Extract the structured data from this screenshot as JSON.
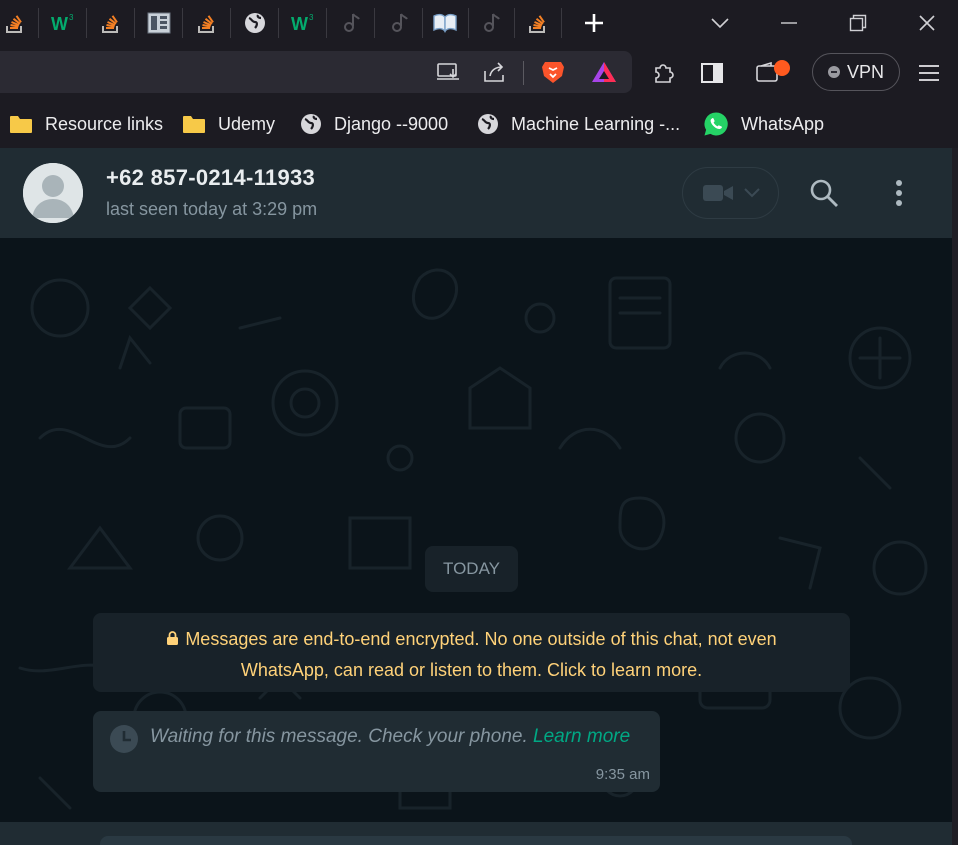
{
  "browser": {
    "tabs": [
      {
        "icon": "stackoverflow-icon"
      },
      {
        "icon": "w3schools-icon",
        "glyph": "W",
        "sup": "3"
      },
      {
        "icon": "stackoverflow-icon"
      },
      {
        "icon": "sidebar-panel-icon"
      },
      {
        "icon": "stackoverflow-icon"
      },
      {
        "icon": "globe-icon"
      },
      {
        "icon": "w3schools-icon",
        "glyph": "W",
        "sup": "3"
      },
      {
        "icon": "music-note-icon"
      },
      {
        "icon": "music-note-icon"
      },
      {
        "icon": "book-icon"
      },
      {
        "icon": "music-note-icon"
      },
      {
        "icon": "stackoverflow-icon"
      }
    ],
    "vpn_label": "VPN",
    "colors": {
      "accent_orange": "#f48024",
      "w3_green": "#04aa6d",
      "brave_orange": "#fb542b"
    }
  },
  "bookmarks": [
    {
      "label": "Resource links",
      "icon": "folder-icon"
    },
    {
      "label": "Udemy",
      "icon": "folder-icon"
    },
    {
      "label": "Django --9000",
      "icon": "globe-icon"
    },
    {
      "label": "Machine Learning -...",
      "icon": "globe-icon"
    },
    {
      "label": "WhatsApp",
      "icon": "whatsapp-icon"
    }
  ],
  "chat": {
    "contact_name": "+62 857-0214-11933",
    "last_seen": "last seen today at 3:29 pm",
    "day_label": "TODAY",
    "encryption_notice": "Messages are end-to-end encrypted. No one outside of this chat, not even WhatsApp, can read or listen to them. Click to learn more.",
    "pending_message": {
      "text": "Waiting for this message. Check your phone.",
      "link": "Learn more",
      "time": "9:35 am"
    },
    "colors": {
      "bg": "#0b141a",
      "panel": "#202c33",
      "notice_text": "#ffd279",
      "link": "#00a884"
    }
  }
}
